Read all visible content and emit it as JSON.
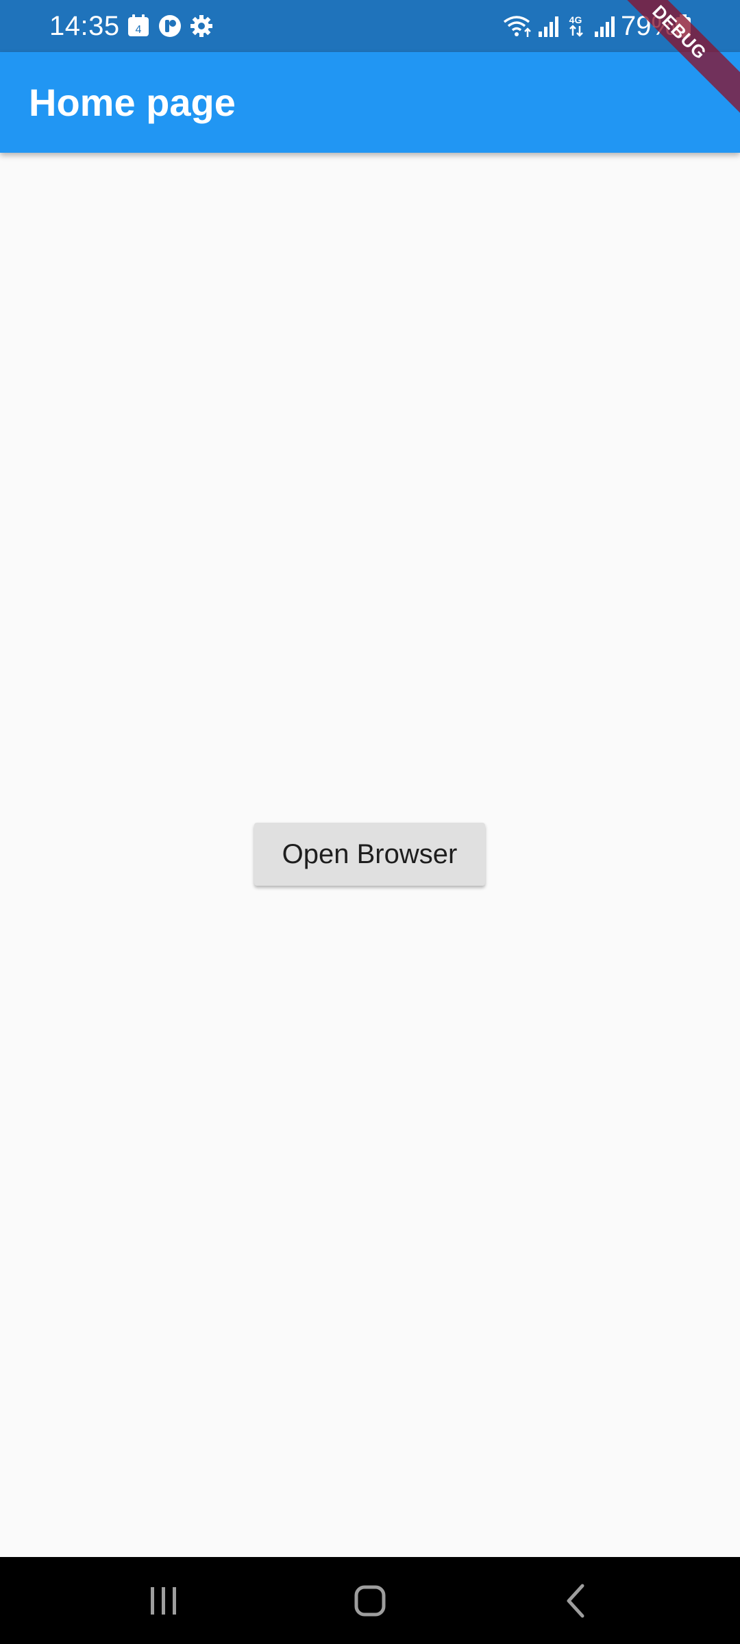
{
  "status_bar": {
    "time": "14:35",
    "calendar_day": "4",
    "battery_percent": "79%",
    "network_type": "4G",
    "icons": [
      "calendar-icon",
      "app-notification-icon",
      "settings-icon",
      "wifi-icon",
      "signal-icon",
      "network-4g-icon",
      "signal-icon",
      "battery-icon"
    ]
  },
  "app_bar": {
    "title": "Home page"
  },
  "debug_banner": {
    "label": "DEBUG"
  },
  "main": {
    "open_browser_label": "Open Browser"
  },
  "nav_bar": {
    "icons": [
      "recent-apps-icon",
      "home-icon",
      "back-icon"
    ]
  },
  "colors": {
    "status_bar": "#1f73bb",
    "app_bar": "#2196f3",
    "background": "#fafafa",
    "button": "#e0e0e0",
    "debug_banner": "#881530"
  }
}
